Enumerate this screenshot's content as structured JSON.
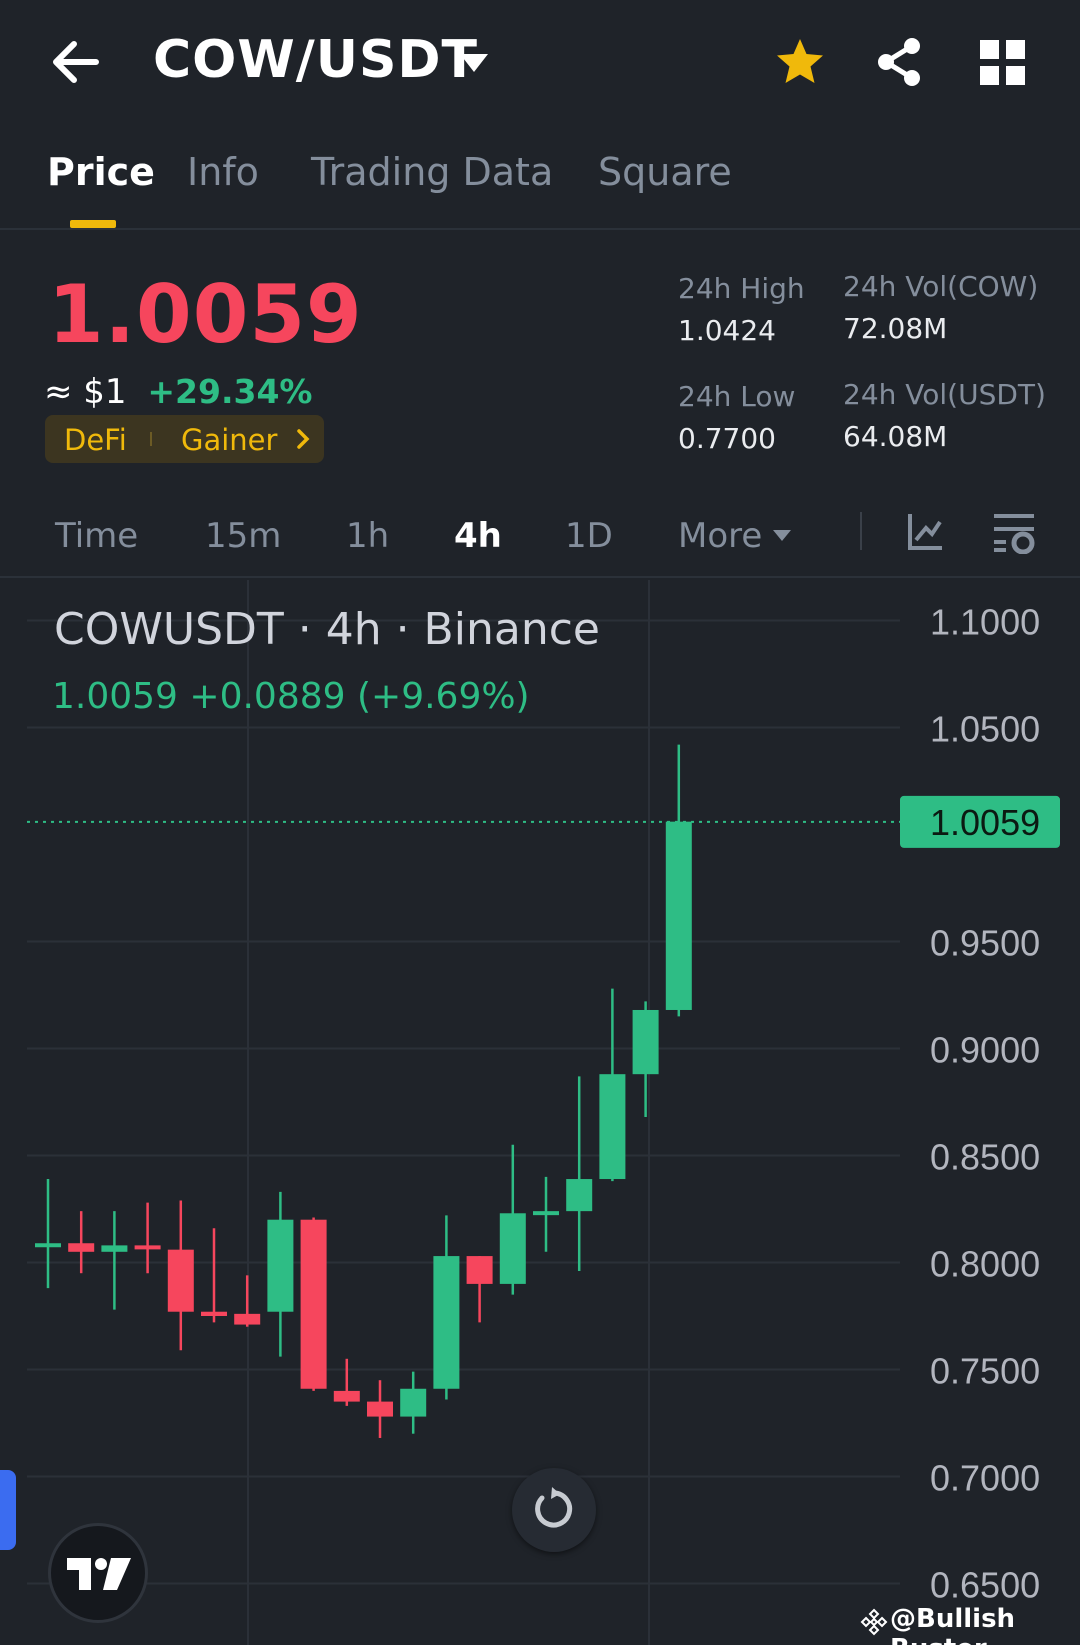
{
  "header": {
    "pair": "COW/USDT",
    "icons": [
      "back-arrow-icon",
      "caret-down-icon",
      "star-icon",
      "share-icon",
      "grid-icon"
    ],
    "star_color": "#f0b90b"
  },
  "tabs": [
    {
      "label": "Price",
      "active": true
    },
    {
      "label": "Info",
      "active": false
    },
    {
      "label": "Trading Data",
      "active": false
    },
    {
      "label": "Square",
      "active": false
    }
  ],
  "ticker": {
    "last_price": "1.0059",
    "fiat": "≈ $1",
    "change_24h": "+29.34%",
    "tags": [
      "DeFi",
      "Gainer"
    ],
    "stats": {
      "high_label": "24h High",
      "high_value": "1.0424",
      "vol_base_label": "24h Vol(COW)",
      "vol_base_value": "72.08M",
      "low_label": "24h Low",
      "low_value": "0.7700",
      "vol_quote_label": "24h Vol(USDT)",
      "vol_quote_value": "64.08M"
    },
    "colors": {
      "down": "#f6465d",
      "up": "#2ebd85",
      "accent": "#f0b90b"
    }
  },
  "intervals": [
    {
      "label": "Time",
      "active": false
    },
    {
      "label": "15m",
      "active": false
    },
    {
      "label": "1h",
      "active": false
    },
    {
      "label": "4h",
      "active": true
    },
    {
      "label": "1D",
      "active": false
    },
    {
      "label": "More",
      "active": false
    }
  ],
  "chart": {
    "title": "COWUSDT · 4h · Binance",
    "ohlc": "1.0059  +0.0889 (+9.69%)",
    "price_tag": "1.0059"
  },
  "chart_data": {
    "type": "candlestick",
    "y_ticks": [
      "1.1000",
      "1.0500",
      "0.9500",
      "0.9000",
      "0.8500",
      "0.8000",
      "0.7500",
      "0.7000",
      "0.6500"
    ],
    "ylim": [
      0.65,
      1.1
    ],
    "last_price": 1.0059,
    "candles": [
      {
        "o": 0.808,
        "h": 0.839,
        "l": 0.788,
        "c": 0.809
      },
      {
        "o": 0.809,
        "h": 0.824,
        "l": 0.795,
        "c": 0.805
      },
      {
        "o": 0.805,
        "h": 0.824,
        "l": 0.778,
        "c": 0.808
      },
      {
        "o": 0.808,
        "h": 0.828,
        "l": 0.795,
        "c": 0.807
      },
      {
        "o": 0.806,
        "h": 0.829,
        "l": 0.759,
        "c": 0.777
      },
      {
        "o": 0.777,
        "h": 0.816,
        "l": 0.772,
        "c": 0.775
      },
      {
        "o": 0.776,
        "h": 0.794,
        "l": 0.77,
        "c": 0.771
      },
      {
        "o": 0.777,
        "h": 0.833,
        "l": 0.756,
        "c": 0.82
      },
      {
        "o": 0.82,
        "h": 0.821,
        "l": 0.74,
        "c": 0.741
      },
      {
        "o": 0.74,
        "h": 0.755,
        "l": 0.733,
        "c": 0.735
      },
      {
        "o": 0.735,
        "h": 0.745,
        "l": 0.718,
        "c": 0.728
      },
      {
        "o": 0.728,
        "h": 0.749,
        "l": 0.72,
        "c": 0.741
      },
      {
        "o": 0.741,
        "h": 0.822,
        "l": 0.736,
        "c": 0.803
      },
      {
        "o": 0.803,
        "h": 0.803,
        "l": 0.772,
        "c": 0.79
      },
      {
        "o": 0.79,
        "h": 0.855,
        "l": 0.785,
        "c": 0.823
      },
      {
        "o": 0.823,
        "h": 0.84,
        "l": 0.805,
        "c": 0.824
      },
      {
        "o": 0.824,
        "h": 0.887,
        "l": 0.796,
        "c": 0.839
      },
      {
        "o": 0.839,
        "h": 0.928,
        "l": 0.838,
        "c": 0.888
      },
      {
        "o": 0.888,
        "h": 0.922,
        "l": 0.868,
        "c": 0.918
      },
      {
        "o": 0.918,
        "h": 1.042,
        "l": 0.915,
        "c": 1.006
      }
    ]
  },
  "watermark": "@Bullish Buster"
}
